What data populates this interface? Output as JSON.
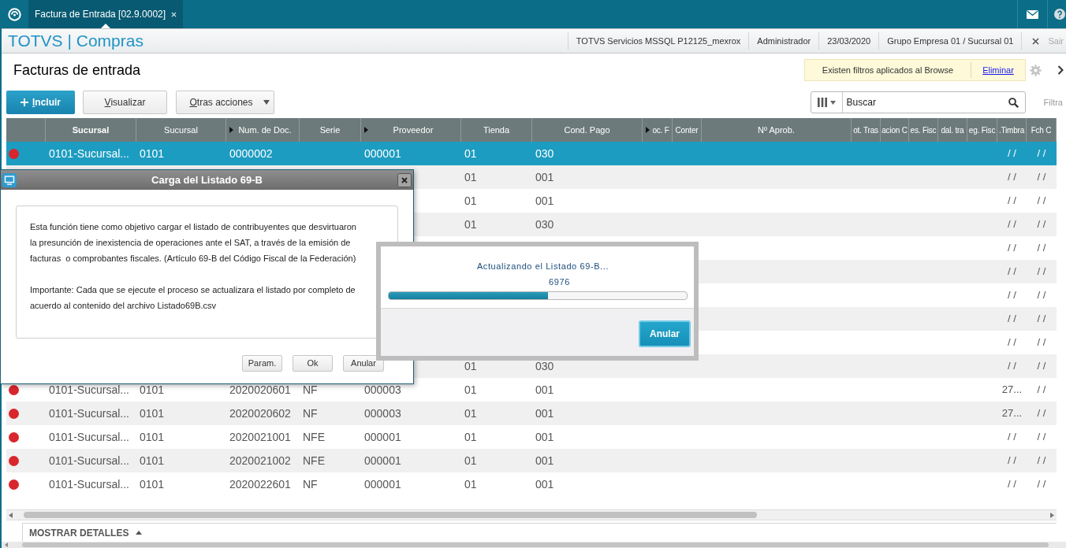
{
  "top_bar": {
    "tabs": [
      {
        "label": "Factura de Entrada [02.9.0002]",
        "selected": true
      }
    ]
  },
  "app_bar": {
    "title": "TOTVS | Compras",
    "info": [
      "TOTVS Servicios MSSQL P12125_mexrox",
      "Administrador",
      "23/03/2020",
      "Grupo Empresa 01 / Sucursal 01"
    ],
    "exit": {
      "label": "Sair",
      "disabled": true
    }
  },
  "page": {
    "title": "Facturas de entrada",
    "filter_notice": {
      "text": "Existen filtros aplicados al Browse",
      "link": "Eliminar"
    }
  },
  "toolbar": {
    "buttons": [
      {
        "label": "Incluir",
        "kind": "primary"
      },
      {
        "label": "Visualizar",
        "kind": "default"
      },
      {
        "label": "Otras acciones",
        "kind": "menu"
      }
    ],
    "search": {
      "placeholder": "Buscar"
    },
    "filter_label": "Filtra"
  },
  "table": {
    "columns": [
      {
        "label": "Sucursal",
        "sorted": true,
        "marker": false
      },
      {
        "label": "Sucursal",
        "sorted": false,
        "marker": false
      },
      {
        "label": "Num. de Doc.",
        "sorted": false,
        "marker": true
      },
      {
        "label": "Serie",
        "sorted": false,
        "marker": false
      },
      {
        "label": "Proveedor",
        "sorted": false,
        "marker": true
      },
      {
        "label": "Tienda",
        "sorted": false,
        "marker": false
      },
      {
        "label": "Cond. Pago",
        "sorted": false,
        "marker": false
      },
      {
        "label": "oc. F",
        "sorted": false,
        "marker": true
      },
      {
        "label": "Conter",
        "sorted": false,
        "marker": false
      },
      {
        "label": "Nº Aprob.",
        "sorted": false,
        "marker": false
      },
      {
        "label": "ot. Tras",
        "sorted": false,
        "marker": false
      },
      {
        "label": "acion C",
        "sorted": false,
        "marker": false
      },
      {
        "label": "es. Fisc",
        "sorted": false,
        "marker": false
      },
      {
        "label": "dal. tra",
        "sorted": false,
        "marker": false
      },
      {
        "label": "eg. Fisc",
        "sorted": false,
        "marker": false
      },
      {
        "label": ".Timbra",
        "sorted": false,
        "marker": false
      },
      {
        "label": "Fch C",
        "sorted": false,
        "marker": false
      }
    ],
    "rows": [
      {
        "selected": true,
        "color": "#d8262c",
        "cells": {
          "sucursal": "0101-Sucursal...",
          "sucursal_2": "0101",
          "num_doc": "0000002",
          "proveedor": "000001",
          "tienda": "01",
          "cond_pago": "030",
          "timbra": "/ /",
          "fch_c": "/ /"
        }
      },
      {
        "selected": false,
        "cells": {
          "tienda": "01",
          "cond_pago": "001",
          "timbra": "/ /",
          "fch_c": "/ /"
        }
      },
      {
        "selected": false,
        "cells": {
          "tienda": "01",
          "cond_pago": "001",
          "timbra": "/ /",
          "fch_c": "/ /"
        }
      },
      {
        "selected": false,
        "cells": {
          "tienda": "01",
          "cond_pago": "030",
          "timbra": "/ /",
          "fch_c": "/ /"
        }
      },
      {
        "selected": false,
        "cells": {
          "timbra": "/ /",
          "fch_c": "/ /"
        }
      },
      {
        "selected": false,
        "cells": {
          "timbra": "/ /",
          "fch_c": "/ /"
        }
      },
      {
        "selected": false,
        "cells": {
          "timbra": "/ /",
          "fch_c": "/ /"
        }
      },
      {
        "selected": false,
        "cells": {
          "timbra": "/ /",
          "fch_c": "/ /"
        }
      },
      {
        "selected": false,
        "cells": {
          "timbra": "/ /",
          "fch_c": "/ /"
        }
      },
      {
        "selected": false,
        "cells": {
          "tienda": "01",
          "cond_pago": "030",
          "timbra": "/ /",
          "fch_c": "/ /"
        }
      },
      {
        "selected": false,
        "color": "#d8262c",
        "cells": {
          "sucursal": "0101-Sucursal...",
          "sucursal_2": "0101",
          "num_doc": "2020020601",
          "serie": "NF",
          "proveedor": "000003",
          "tienda": "01",
          "cond_pago": "001",
          "timbra": "27...",
          "fch_c": "/ /"
        }
      },
      {
        "selected": false,
        "color": "#d8262c",
        "cells": {
          "sucursal": "0101-Sucursal...",
          "sucursal_2": "0101",
          "num_doc": "2020020602",
          "serie": "NF",
          "proveedor": "000003",
          "tienda": "01",
          "cond_pago": "001",
          "timbra": "27...",
          "fch_c": "/ /"
        }
      },
      {
        "selected": false,
        "color": "#d8262c",
        "cells": {
          "sucursal": "0101-Sucursal...",
          "sucursal_2": "0101",
          "num_doc": "2020021001",
          "serie": "NFE",
          "proveedor": "000001",
          "tienda": "01",
          "cond_pago": "001",
          "timbra": "/ /",
          "fch_c": "/ /"
        }
      },
      {
        "selected": false,
        "color": "#d8262c",
        "cells": {
          "sucursal": "0101-Sucursal...",
          "sucursal_2": "0101",
          "num_doc": "2020021002",
          "serie": "NFE",
          "proveedor": "000001",
          "tienda": "01",
          "cond_pago": "001",
          "timbra": "/ /",
          "fch_c": "/ /"
        }
      },
      {
        "selected": false,
        "color": "#d8262c",
        "cells": {
          "sucursal": "0101-Sucursal...",
          "sucursal_2": "0101",
          "num_doc": "2020022601",
          "serie": "NF",
          "proveedor": "000001",
          "tienda": "01",
          "cond_pago": "001",
          "timbra": "/ /",
          "fch_c": "/ /"
        }
      }
    ]
  },
  "details_bar": {
    "label": "MOSTRAR DETALLES",
    "expanded": false
  },
  "dialog": {
    "title": "Carga del Listado 69-B",
    "paragraphs": [
      "Esta función tiene como objetivo cargar el listado de contribuyentes que desvirtuaron\nla presunción de inexistencia de operaciones ante el SAT, a través de la emisión de\nfacturas  o comprobantes fiscales. (Artículo 69-B del Código Fiscal de la Federación)",
      "Importante: Cada que se ejecute el proceso se actualizara el listado por completo de\nacuerdo al contenido del archivo Listado69B.csv"
    ],
    "buttons": [
      {
        "label": "Param."
      },
      {
        "label": "Ok"
      },
      {
        "label": "Anular"
      }
    ]
  },
  "progress_dialog": {
    "message": "Actualizando el Listado 69-B...",
    "count": "6976",
    "level": 0.535,
    "button": "Anular"
  }
}
